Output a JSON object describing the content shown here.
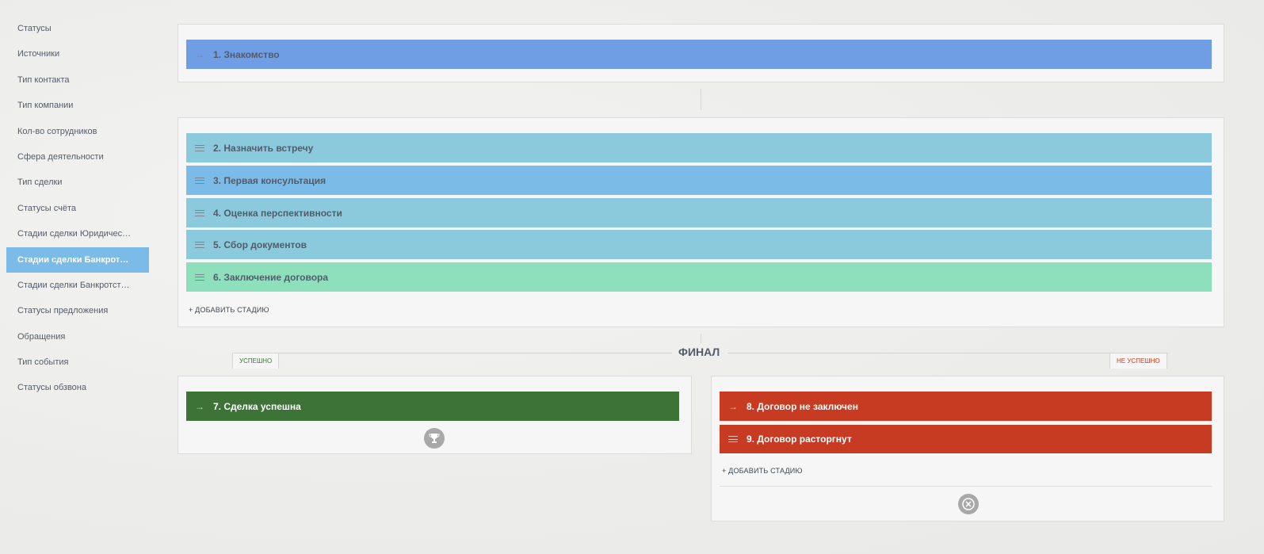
{
  "sidebar": {
    "items": [
      {
        "label": "Статусы"
      },
      {
        "label": "Источники"
      },
      {
        "label": "Тип контакта"
      },
      {
        "label": "Тип компании"
      },
      {
        "label": "Кол-во сотрудников"
      },
      {
        "label": "Сфера деятельности"
      },
      {
        "label": "Тип сделки"
      },
      {
        "label": "Статусы счёта"
      },
      {
        "label": "Стадии сделки Юридичес…"
      },
      {
        "label": "Стадии сделки Банкрот…"
      },
      {
        "label": "Стадии сделки Банкротст…"
      },
      {
        "label": "Статусы предложения"
      },
      {
        "label": "Обращения"
      },
      {
        "label": "Тип события"
      },
      {
        "label": "Статусы обзвона"
      }
    ],
    "active_index": 9
  },
  "initial": {
    "stage": {
      "label": "1. Знакомство",
      "color": "#6f9ee5",
      "icon": "arrow-right-icon"
    }
  },
  "process": {
    "stages": [
      {
        "label": "2. Назначить встречу",
        "color": "#8bcadc"
      },
      {
        "label": "3. Первая консультация",
        "color": "#7bbbe8"
      },
      {
        "label": "4. Оценка перспективности",
        "color": "#8bcadc"
      },
      {
        "label": "5. Сбор документов",
        "color": "#8bcadc"
      },
      {
        "label": "6. Заключение договора",
        "color": "#8ee0bd"
      }
    ],
    "add_label": "+ ДОБАВИТЬ СТАДИЮ"
  },
  "final": {
    "title": "ФИНАЛ",
    "success_tab": "УСПЕШНО",
    "fail_tab": "НЕ УСПЕШНО",
    "success_color": "#3e7338",
    "fail_color": "#c63b21",
    "success_stage": {
      "label": "7. Сделка успешна",
      "color": "#3e7338"
    },
    "fail_stages": [
      {
        "label": "8. Договор не заключен",
        "color": "#c63b21"
      },
      {
        "label": "9. Договор расторгнут",
        "color": "#c63b21"
      }
    ],
    "fail_add_label": "+ ДОБАВИТЬ СТАДИЮ",
    "success_icon": "trophy-icon",
    "fail_icon": "cancel-circle-icon"
  }
}
